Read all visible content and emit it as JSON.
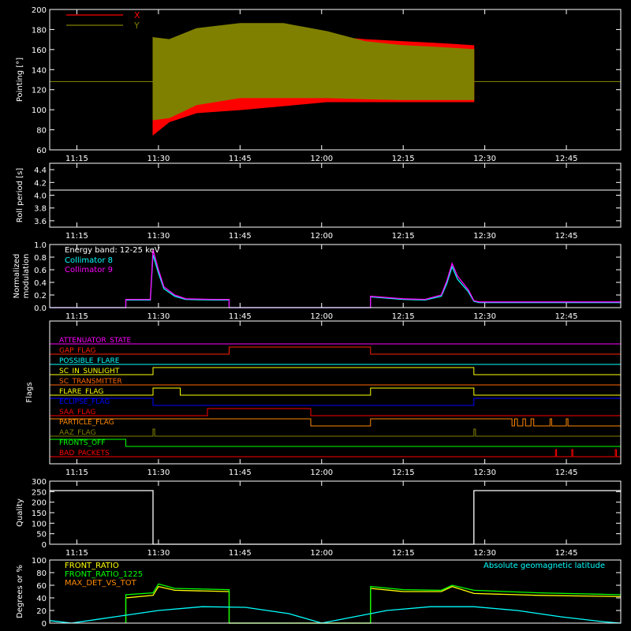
{
  "chart_data": [
    {
      "type": "line",
      "title": "",
      "xlabel": "",
      "ylabel": "Pointing [°]",
      "x_ticks": [
        "11:15",
        "11:30",
        "11:45",
        "12:00",
        "12:15",
        "12:30",
        "12:45"
      ],
      "ylim": [
        60,
        200
      ],
      "y_ticks": [
        "60",
        "80",
        "100",
        "120",
        "140",
        "160",
        "180",
        "200"
      ],
      "legend": [
        {
          "name": "X",
          "color": "#ff0000"
        },
        {
          "name": "Y",
          "color": "#808000"
        }
      ],
      "baseline_y": 128,
      "active_window": [
        "11:29",
        "12:28"
      ],
      "envelope": {
        "x": [
          "11:29",
          "11:32",
          "11:37",
          "11:45",
          "11:53",
          "12:01",
          "12:08",
          "12:15",
          "12:22",
          "12:28"
        ],
        "Y_upper": [
          172,
          170,
          181,
          186,
          186,
          178,
          168,
          164,
          162,
          160
        ],
        "Y_lower": [
          90,
          92,
          105,
          112,
          112,
          112,
          111,
          110,
          110,
          110
        ],
        "X_upper": [
          172,
          166,
          176,
          180,
          178,
          173,
          170,
          168,
          166,
          164
        ],
        "X_lower": [
          75,
          88,
          97,
          100,
          104,
          108,
          108,
          108,
          108,
          108
        ]
      }
    },
    {
      "type": "line",
      "ylabel": "Roll period [s]",
      "x_ticks": [
        "11:15",
        "11:30",
        "11:45",
        "12:00",
        "12:15",
        "12:30",
        "12:45"
      ],
      "ylim": [
        3.5,
        4.5
      ],
      "y_ticks": [
        "3.6",
        "3.8",
        "4.0",
        "4.2",
        "4.4"
      ],
      "series": [
        {
          "name": "",
          "color": "#ffffff",
          "value": 4.08
        }
      ]
    },
    {
      "type": "line",
      "ylabel": "Normalized modulation",
      "annotation": "Energy band: 12-25 keV",
      "x_ticks": [
        "11:15",
        "11:30",
        "11:45",
        "12:00",
        "12:15",
        "12:30",
        "12:45"
      ],
      "ylim": [
        0,
        1.0
      ],
      "y_ticks": [
        "0.0",
        "0.2",
        "0.4",
        "0.6",
        "0.8",
        "1.0"
      ],
      "series": [
        {
          "name": "Collimator 8",
          "color": "#00ffff",
          "x": [
            "11:10",
            "11:24",
            "11:24",
            "11:28.5",
            "11:29",
            "11:30",
            "11:31",
            "11:33",
            "11:35",
            "11:40",
            "11:43",
            "11:43",
            "12:09",
            "12:09",
            "12:15",
            "12:19",
            "12:22",
            "12:23",
            "12:24",
            "12:25",
            "12:27",
            "12:28",
            "12:29",
            "12:35",
            "12:45",
            "12:55"
          ],
          "y": [
            0.0,
            0.0,
            0.12,
            0.12,
            0.84,
            0.55,
            0.3,
            0.18,
            0.13,
            0.12,
            0.12,
            0.0,
            0.0,
            0.17,
            0.13,
            0.12,
            0.18,
            0.38,
            0.65,
            0.45,
            0.25,
            0.1,
            0.08,
            0.08,
            0.08,
            0.08
          ]
        },
        {
          "name": "Collimator 9",
          "color": "#ff00ff",
          "x": [
            "11:10",
            "11:24",
            "11:24",
            "11:28.5",
            "11:29",
            "11:30",
            "11:31",
            "11:33",
            "11:35",
            "11:40",
            "11:43",
            "11:43",
            "12:09",
            "12:09",
            "12:15",
            "12:19",
            "12:22",
            "12:23",
            "12:24",
            "12:25",
            "12:27",
            "12:28",
            "12:29",
            "12:35",
            "12:45",
            "12:55"
          ],
          "y": [
            0.0,
            0.0,
            0.13,
            0.13,
            0.92,
            0.6,
            0.33,
            0.2,
            0.14,
            0.13,
            0.13,
            0.0,
            0.0,
            0.18,
            0.14,
            0.13,
            0.2,
            0.42,
            0.7,
            0.5,
            0.28,
            0.11,
            0.09,
            0.09,
            0.09,
            0.09
          ]
        }
      ]
    },
    {
      "type": "line",
      "ylabel": "Flags",
      "x_ticks": [
        "11:15",
        "11:30",
        "11:45",
        "12:00",
        "12:15",
        "12:30",
        "12:45"
      ],
      "flags": [
        {
          "name": "ATTENUATOR_STATE",
          "color": "#ff00ff",
          "highs": []
        },
        {
          "name": "GAP_FLAG",
          "color": "#ff2200",
          "highs": [
            [
              "11:43",
              "12:09"
            ]
          ]
        },
        {
          "name": "POSSIBLE_FLARE",
          "color": "#00ffff",
          "highs": []
        },
        {
          "name": "SC_IN_SUNLIGHT",
          "color": "#ffff00",
          "highs": [
            [
              "11:29",
              "12:28"
            ]
          ]
        },
        {
          "name": "SC_TRANSMITTER",
          "color": "#ff6600",
          "highs": []
        },
        {
          "name": "FLARE_FLAG",
          "color": "#ffff00",
          "highs": [
            [
              "11:29",
              "11:34"
            ],
            [
              "12:09",
              "12:28"
            ]
          ]
        },
        {
          "name": "ECLIPSE_FLAG",
          "color": "#0000ff",
          "highs": [
            [
              "11:10",
              "11:29"
            ],
            [
              "12:28",
              "12:55"
            ]
          ]
        },
        {
          "name": "SAA_FLAG",
          "color": "#ff0000",
          "highs": [
            [
              "11:39",
              "11:58"
            ]
          ]
        },
        {
          "name": "PARTICLE_FLAG",
          "color": "#ff8800",
          "highs": [
            [
              "11:10",
              "11:58"
            ],
            [
              "12:09",
              "12:35"
            ],
            [
              "12:35.5",
              "12:36"
            ],
            [
              "12:37",
              "12:37.5"
            ],
            [
              "12:38.5",
              "12:39"
            ],
            [
              "12:42",
              "12:42.3"
            ],
            [
              "12:45",
              "12:45.3"
            ]
          ]
        },
        {
          "name": "AAZ_FLAG",
          "color": "#808000",
          "highs": [
            [
              "11:29",
              "11:29.3"
            ],
            [
              "12:28",
              "12:28.3"
            ]
          ]
        },
        {
          "name": "FRONTS_OFF",
          "color": "#00ff00",
          "highs": [
            [
              "11:10",
              "11:24"
            ]
          ]
        },
        {
          "name": "BAD_PACKETS",
          "color": "#ff0000",
          "highs": [
            [
              "12:43",
              "12:43.2"
            ],
            [
              "12:46",
              "12:46.2"
            ],
            [
              "12:54",
              "12:54.2"
            ]
          ]
        }
      ]
    },
    {
      "type": "line",
      "ylabel": "Quality",
      "x_ticks": [
        "11:15",
        "11:30",
        "11:45",
        "12:00",
        "12:15",
        "12:30",
        "12:45"
      ],
      "ylim": [
        0,
        300
      ],
      "y_ticks": [
        "0",
        "50",
        "100",
        "150",
        "200",
        "250",
        "300"
      ],
      "series": [
        {
          "name": "",
          "color": "#ffffff",
          "x": [
            "11:10",
            "11:29",
            "11:29",
            "12:28",
            "12:28",
            "12:55"
          ],
          "y": [
            255,
            255,
            0,
            0,
            255,
            255
          ]
        }
      ]
    },
    {
      "type": "line",
      "ylabel": "Degrees or %",
      "x_ticks": [],
      "ylim": [
        0,
        100
      ],
      "y_ticks": [
        "0",
        "20",
        "40",
        "60",
        "80",
        "100"
      ],
      "series": [
        {
          "name": "FRONT_RATIO",
          "color": "#ffff00",
          "x": [
            "11:24",
            "11:24",
            "11:29",
            "11:30",
            "11:33",
            "11:43",
            "11:43",
            "12:09",
            "12:09",
            "12:15",
            "12:22",
            "12:24",
            "12:28",
            "12:40",
            "12:55"
          ],
          "y": [
            0,
            40,
            44,
            58,
            52,
            50,
            0,
            0,
            55,
            50,
            50,
            58,
            47,
            44,
            42
          ]
        },
        {
          "name": "FRONT_RATIO_1225",
          "color": "#00ff00",
          "x": [
            "11:24",
            "11:24",
            "11:29",
            "11:30",
            "11:33",
            "11:43",
            "11:43",
            "12:09",
            "12:09",
            "12:15",
            "12:22",
            "12:24",
            "12:28",
            "12:40",
            "12:55"
          ],
          "y": [
            0,
            45,
            48,
            62,
            55,
            53,
            0,
            0,
            58,
            53,
            52,
            60,
            52,
            48,
            45
          ]
        },
        {
          "name": "MAX_DET_VS_TOT",
          "color": "#ff8800",
          "x": [],
          "y": []
        },
        {
          "name": "Absolute geomagnetic latitude",
          "color": "#00ffff",
          "x": [
            "11:10",
            "11:14",
            "11:22",
            "11:30",
            "11:38",
            "11:46",
            "11:54",
            "12:00",
            "12:06",
            "12:12",
            "12:20",
            "12:28",
            "12:36",
            "12:44",
            "12:52",
            "12:55"
          ],
          "y": [
            4,
            0,
            10,
            20,
            26,
            25,
            15,
            0,
            10,
            20,
            26,
            26,
            20,
            10,
            2,
            0
          ]
        }
      ]
    }
  ]
}
